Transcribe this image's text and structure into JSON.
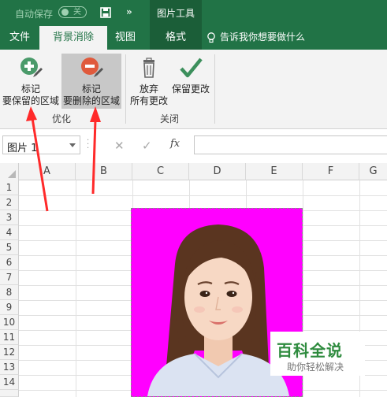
{
  "title_bar": {
    "autosave_label": "自动保存",
    "autosave_state": "关",
    "context_tab_group": "图片工具"
  },
  "tabs": [
    {
      "label": "文件"
    },
    {
      "label": "背景消除",
      "active": true
    },
    {
      "label": "视图"
    },
    {
      "label": "格式"
    }
  ],
  "tell_me": {
    "text": "告诉我你想要做什么"
  },
  "ribbon": {
    "keep_button": {
      "line1": "标记",
      "line2": "要保留的区域",
      "icon": "plus-circle-icon"
    },
    "delete_button": {
      "line1": "标记",
      "line2": "要删除的区域",
      "icon": "minus-circle-icon"
    },
    "discard_button": {
      "line1": "放弃",
      "line2": "所有更改",
      "icon": "trash-icon"
    },
    "save_button": {
      "line1": "保留更改",
      "icon": "checkmark-icon"
    },
    "group_optimize": "优化",
    "group_close": "关闭"
  },
  "formula_bar": {
    "name_box": "图片 1",
    "cancel_symbol": "✕",
    "enter_symbol": "✓",
    "fx_symbol": "fx"
  },
  "grid": {
    "columns": [
      "A",
      "B",
      "C",
      "D",
      "E",
      "F",
      "G"
    ],
    "rows": [
      "1",
      "2",
      "3",
      "4",
      "5",
      "6",
      "7",
      "8",
      "9",
      "10",
      "11",
      "12",
      "13",
      "14"
    ]
  },
  "watermark": {
    "title": "百科全说",
    "subtitle": "助你轻松解决"
  },
  "colors": {
    "excel_green": "#217346",
    "removal_background": "#ff00ff",
    "annotation_red": "#ff2a2a"
  }
}
